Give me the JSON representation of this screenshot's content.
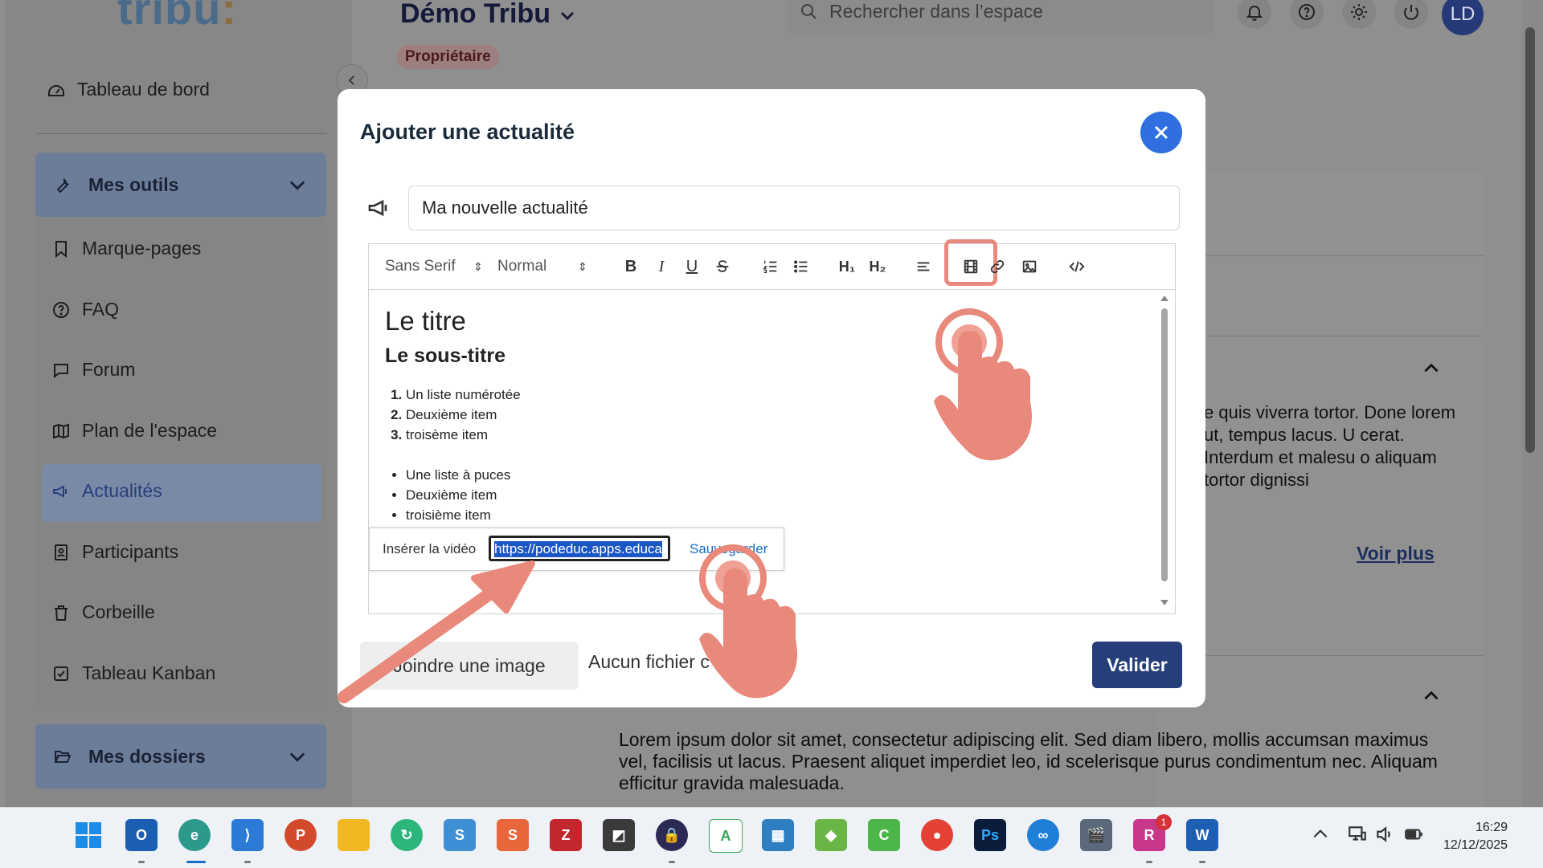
{
  "app": {
    "logo_text": "tribu",
    "logo_dot": ":",
    "space_title": "Démo Tribu",
    "role_badge": "Propriétaire",
    "search_placeholder": "Rechercher dans l’espace",
    "avatar_initials": "LD"
  },
  "sidebar": {
    "dashboard": "Tableau de bord",
    "tools_group": "Mes outils",
    "items": [
      {
        "label": "Marque-pages",
        "icon": "bookmark-icon"
      },
      {
        "label": "FAQ",
        "icon": "help-circle-icon"
      },
      {
        "label": "Forum",
        "icon": "chat-icon"
      },
      {
        "label": "Plan de l'espace",
        "icon": "map-icon"
      },
      {
        "label": "Actualités",
        "icon": "megaphone-icon"
      },
      {
        "label": "Participants",
        "icon": "contact-icon"
      },
      {
        "label": "Corbeille",
        "icon": "trash-icon"
      },
      {
        "label": "Tableau Kanban",
        "icon": "checkbox-icon"
      }
    ],
    "folders_group": "Mes dossiers"
  },
  "background": {
    "snippet": "e quis viverra tortor. Done lorem ut, tempus lacus. U cerat. Interdum et malesu o aliquam tortor dignissi",
    "voir_plus": "Voir plus",
    "paragraph": "Lorem ipsum dolor sit amet, consectetur adipiscing elit. Sed diam libero, mollis accumsan maximus vel, facilisis ut lacus. Praesent aliquet imperdiet leo, id scelerisque purus condimentum nec. Aliquam efficitur gravida malesuada."
  },
  "modal": {
    "title": "Ajouter une actualité",
    "title_input_value": "Ma nouvelle actualité",
    "toolbar": {
      "font": "Sans Serif",
      "size": "Normal",
      "bold": "B",
      "italic": "I",
      "underline": "U",
      "h1": "H₁",
      "h2": "H₂"
    },
    "content": {
      "heading1": "Le titre",
      "heading2": "Le sous-titre",
      "ordered": [
        "Un liste numérotée",
        "Deuxième item",
        "troisème item"
      ],
      "bullets": [
        "Une liste à puces",
        "Deuxième item",
        "troisième item"
      ]
    },
    "video_tooltip": {
      "label": "Insérer la vidéo",
      "url": "https://podeduc.apps.educa",
      "save": "Sauvegarder"
    },
    "attach_button": "Joindre une image",
    "no_file": "Aucun fichier c",
    "submit": "Valider"
  },
  "taskbar": {
    "time": "16:29",
    "date": "12/12/2025",
    "badge": "1"
  },
  "colors": {
    "accent": "#2f6fe0",
    "primary_button": "#263f7a",
    "annotation": "#e8897b"
  }
}
